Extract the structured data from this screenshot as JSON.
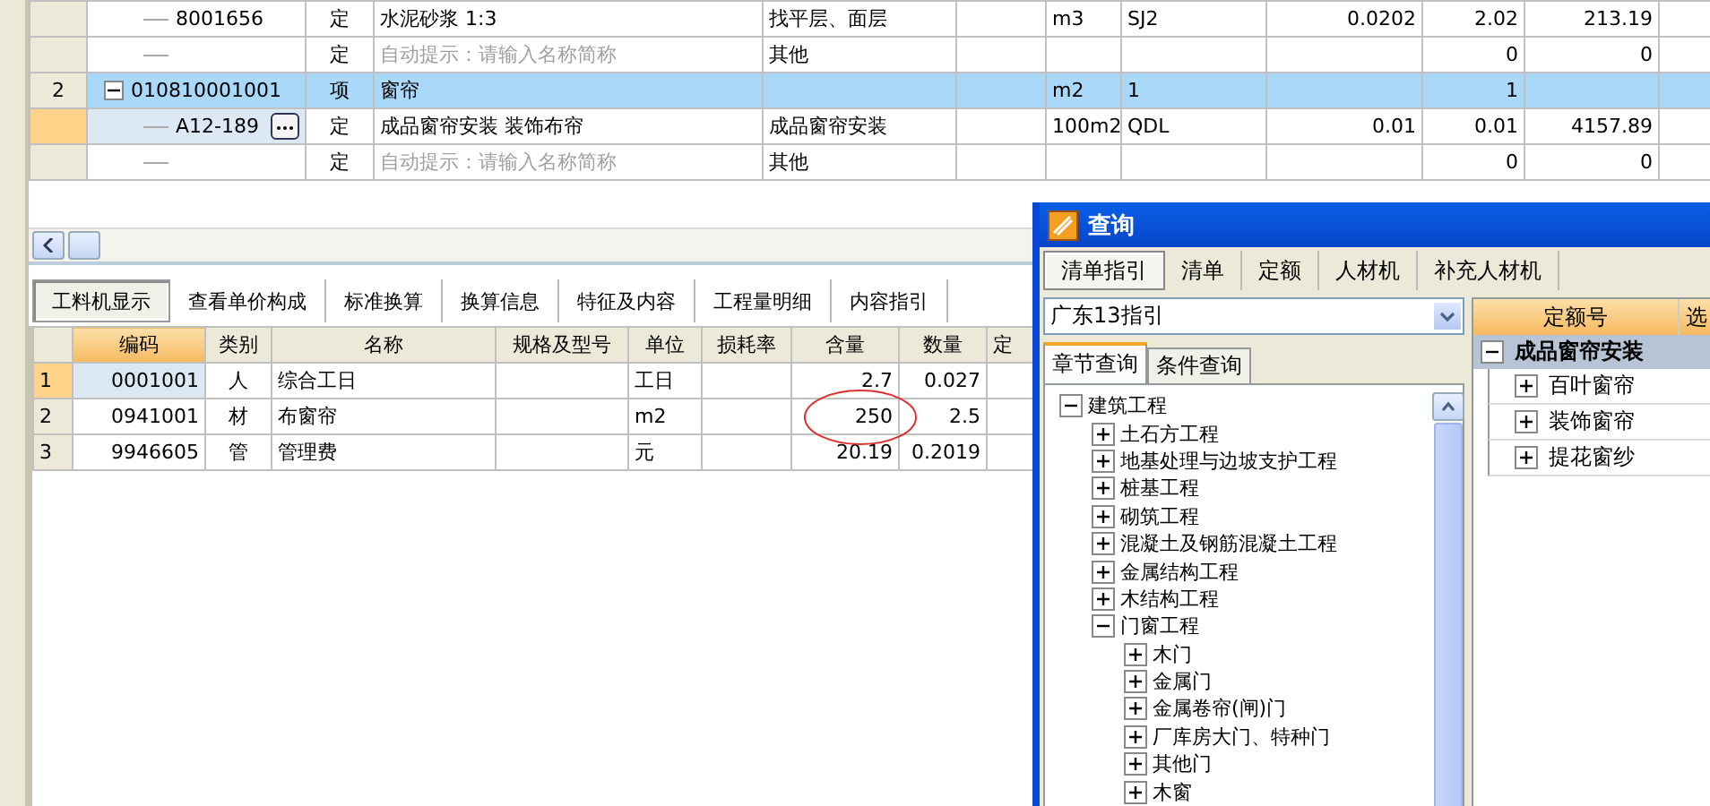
{
  "top_grid": {
    "rows": [
      {
        "kind": "item",
        "code": "8001656",
        "type": "定",
        "name": "水泥砂浆 1:3",
        "name_is_hint": false,
        "feature": "找平层、面层",
        "unit": "m3",
        "column_8": "SJ2",
        "column_9": "0.0202",
        "column_10": "2.02",
        "column_11": "213.19",
        "selected": false,
        "current": false
      },
      {
        "kind": "item",
        "type": "定",
        "name": "自动提示：请输入名称简称",
        "name_is_hint": true,
        "feature": "其他",
        "column_10": "0",
        "column_11": "0",
        "selected": false,
        "current": false
      },
      {
        "kind": "group",
        "number": "2",
        "code": "010810001001",
        "type": "项",
        "name": "窗帘",
        "name_is_hint": false,
        "unit": "m2",
        "column_8": "1",
        "column_10": "1",
        "selected": true,
        "current": false,
        "expanded": true,
        "children": [
          {
            "kind": "item",
            "code": "A12-189",
            "type": "定",
            "name": "成品窗帘安装 装饰布帘",
            "name_is_hint": false,
            "feature": "成品窗帘安装",
            "unit": "100m2",
            "column_8": "QDL",
            "column_9": "0.01",
            "column_10": "0.01",
            "column_11": "4157.89",
            "selected": false,
            "current": true
          },
          {
            "kind": "item",
            "type": "定",
            "name": "自动提示：请输入名称简称",
            "name_is_hint": true,
            "feature": "其他",
            "column_10": "0",
            "column_11": "0",
            "selected": false,
            "current": false
          }
        ]
      }
    ]
  },
  "detail_tabs": [
    {
      "label": "工料机显示",
      "selected": true
    },
    {
      "label": "查看单价构成",
      "selected": false
    },
    {
      "label": "标准换算",
      "selected": false
    },
    {
      "label": "换算信息",
      "selected": false
    },
    {
      "label": "特征及内容",
      "selected": false
    },
    {
      "label": "工程量明细",
      "selected": false
    },
    {
      "label": "内容指引",
      "selected": false
    }
  ],
  "resource_grid": {
    "columns": [
      {
        "label": "编码",
        "current": true
      },
      {
        "label": "类别",
        "current": false
      },
      {
        "label": "名称",
        "current": false
      },
      {
        "label": "规格及型号",
        "current": false
      },
      {
        "label": "单位",
        "current": false
      },
      {
        "label": "损耗率",
        "current": false
      },
      {
        "label": "含量",
        "current": false
      },
      {
        "label": "数量",
        "current": false
      },
      {
        "label": "定",
        "current": false
      }
    ],
    "rows": [
      {
        "number": "1",
        "code": "0001001",
        "type": "人",
        "name": "综合工日",
        "unit": "工日",
        "content": "2.7",
        "quantity": "0.027",
        "current": true
      },
      {
        "number": "2",
        "code": "0941001",
        "type": "材",
        "name": "布窗帘",
        "unit": "m2",
        "content": "250",
        "quantity": "2.5",
        "current": false
      },
      {
        "number": "3",
        "code": "9946605",
        "type": "管",
        "name": "管理费",
        "unit": "元",
        "content": "20.19",
        "quantity": "0.2019",
        "current": false
      }
    ]
  },
  "query_window": {
    "title": "查询",
    "tabs": [
      {
        "label": "清单指引",
        "selected": true
      },
      {
        "label": "清单",
        "selected": false
      },
      {
        "label": "定额",
        "selected": false
      },
      {
        "label": "人材机",
        "selected": false
      },
      {
        "label": "补充人材机",
        "selected": false
      }
    ],
    "guide_select": {
      "value": "广东13指引"
    },
    "search_tabs": [
      {
        "label": "章节查询",
        "selected": true
      },
      {
        "label": "条件查询",
        "selected": false
      }
    ],
    "tree": [
      {
        "label": "建筑工程",
        "expanded": true,
        "children": [
          {
            "label": "土石方工程",
            "expanded": false
          },
          {
            "label": "地基处理与边坡支护工程",
            "expanded": false
          },
          {
            "label": "桩基工程",
            "expanded": false
          },
          {
            "label": "砌筑工程",
            "expanded": false
          },
          {
            "label": "混凝土及钢筋混凝土工程",
            "expanded": false
          },
          {
            "label": "金属结构工程",
            "expanded": false
          },
          {
            "label": "木结构工程",
            "expanded": false
          },
          {
            "label": "门窗工程",
            "expanded": true,
            "children": [
              {
                "label": "木门",
                "expanded": false
              },
              {
                "label": "金属门",
                "expanded": false
              },
              {
                "label": "金属卷帘(闸)门",
                "expanded": false
              },
              {
                "label": "厂库房大门、特种门",
                "expanded": false
              },
              {
                "label": "其他门",
                "expanded": false
              },
              {
                "label": "木窗",
                "expanded": false
              }
            ]
          }
        ]
      }
    ],
    "quota_table": {
      "columns": [
        "定额号",
        "选"
      ],
      "groups": [
        {
          "label": "成品窗帘安装",
          "expanded": true,
          "children": [
            {
              "label": "百叶窗帘",
              "expanded": false
            },
            {
              "label": "装饰窗帘",
              "expanded": false
            },
            {
              "label": "提花窗纱",
              "expanded": false
            }
          ]
        }
      ]
    }
  }
}
